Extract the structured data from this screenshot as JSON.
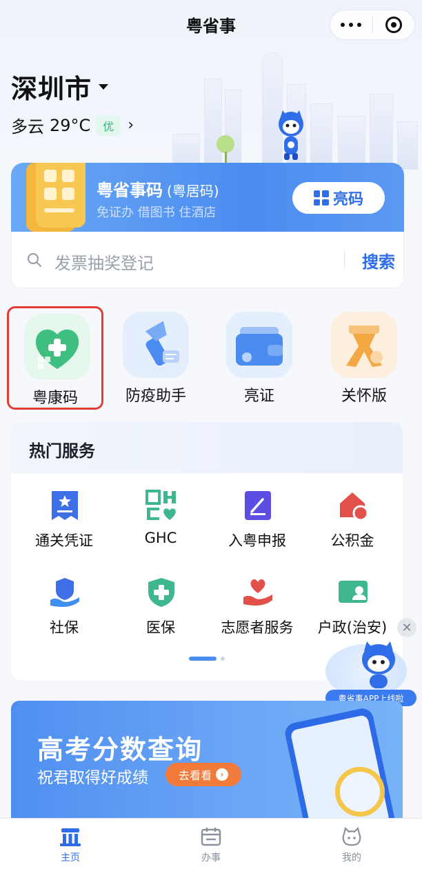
{
  "topbar": {
    "title": "粤省事"
  },
  "location": {
    "city": "深圳市",
    "weather": "多云",
    "temperature": "29°C",
    "aqi": "优"
  },
  "code_card": {
    "title": "粤省事码",
    "subtitle_paren": "(粤居码)",
    "tags": "免证办 借图书 住酒店",
    "button_label": "亮码"
  },
  "search": {
    "placeholder": "发票抽奖登记",
    "button_label": "搜索"
  },
  "quick_apps": [
    {
      "label": "粤康码",
      "icon": "health-code-heart-icon",
      "selected": true
    },
    {
      "label": "防疫助手",
      "icon": "epidemic-helper-icon"
    },
    {
      "label": "亮证",
      "icon": "wallet-certificate-icon"
    },
    {
      "label": "关怀版",
      "icon": "care-ribbon-icon"
    }
  ],
  "hot_services": {
    "title": "热门服务",
    "items": [
      {
        "label": "通关凭证",
        "icon": "customs-pass-icon"
      },
      {
        "label": "GHC",
        "icon": "ghc-icon"
      },
      {
        "label": "入粤申报",
        "icon": "declare-edit-icon"
      },
      {
        "label": "公积金",
        "icon": "housing-fund-icon"
      },
      {
        "label": "社保",
        "icon": "social-security-icon"
      },
      {
        "label": "医保",
        "icon": "medical-insurance-icon"
      },
      {
        "label": "志愿者服务",
        "icon": "volunteer-heart-hand-icon"
      },
      {
        "label": "户政(治安)",
        "icon": "household-id-card-icon"
      }
    ]
  },
  "float_promo": {
    "label": "粤省事APP上线啦"
  },
  "banner": {
    "title": "高考分数查询",
    "subtitle": "祝君取得好成绩",
    "button_label": "去看看"
  },
  "tabbar": [
    {
      "label": "主页",
      "icon": "home-building-icon",
      "active": true
    },
    {
      "label": "办事",
      "icon": "calendar-icon"
    },
    {
      "label": "我的",
      "icon": "mascot-face-icon"
    }
  ],
  "colors": {
    "accent": "#2f6ee8",
    "highlight_border": "#e23b31",
    "card_blue": "#4b8cf0"
  }
}
